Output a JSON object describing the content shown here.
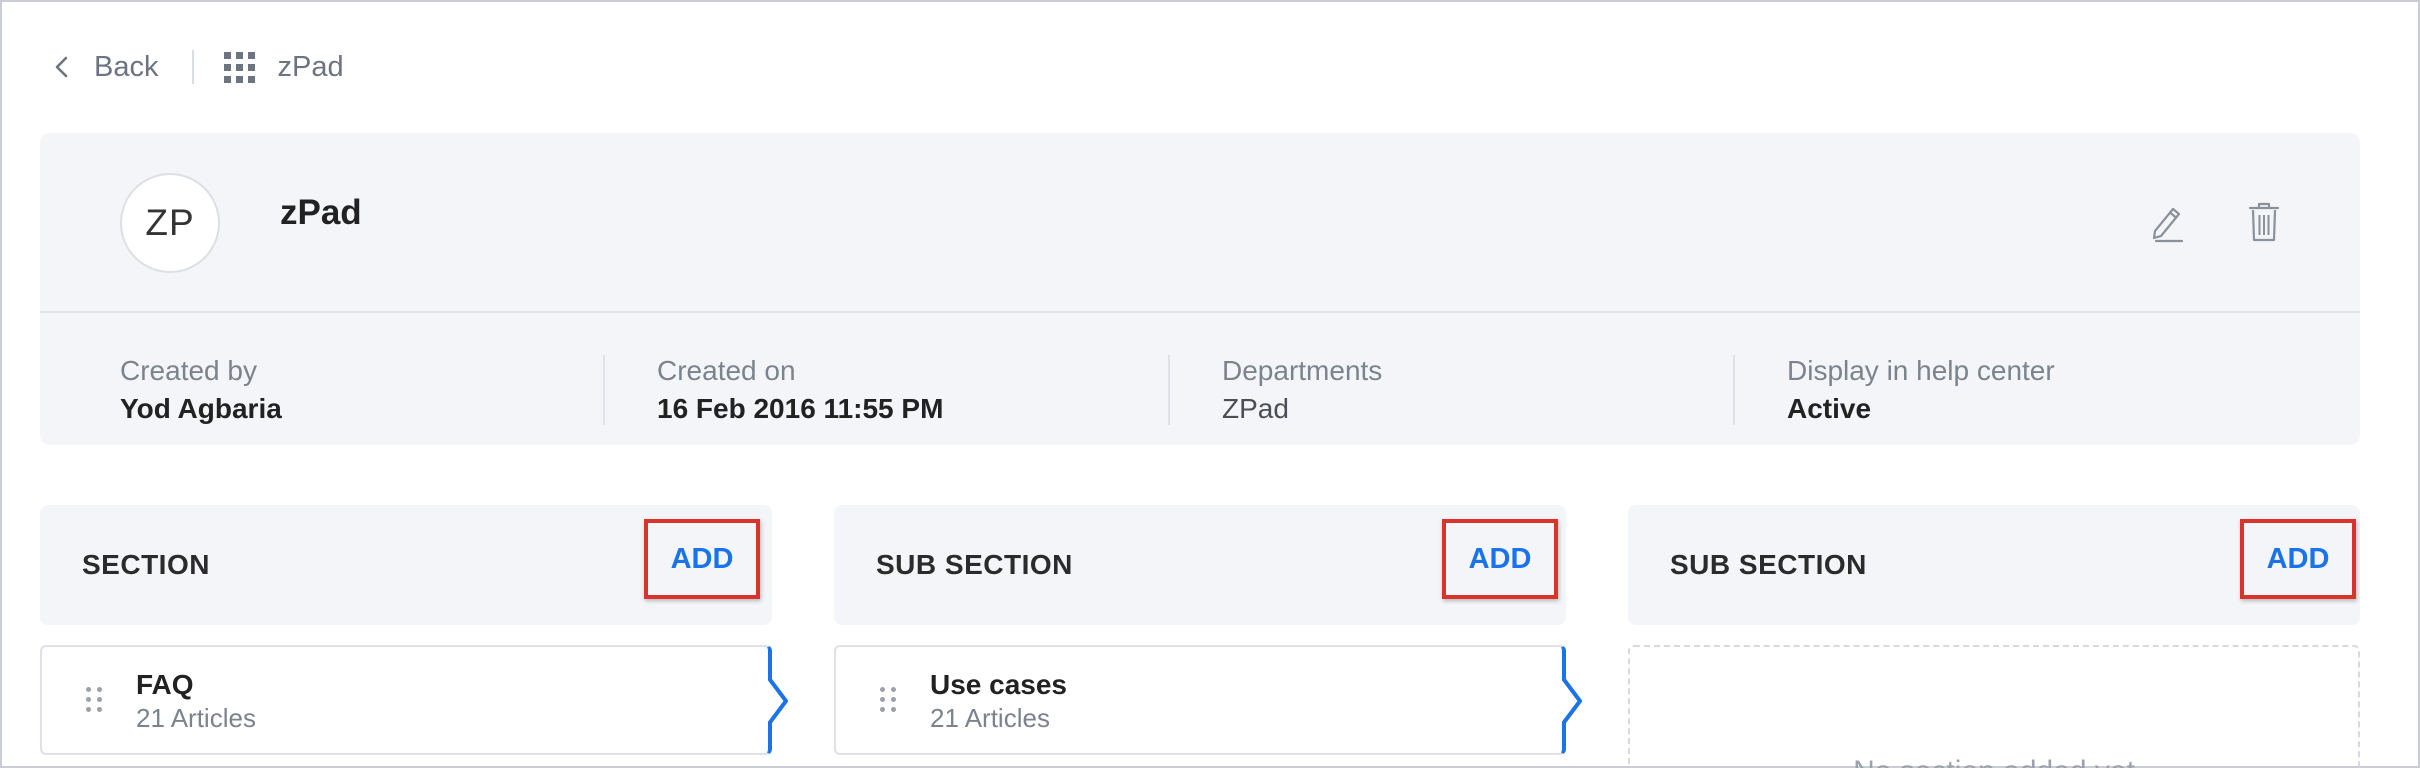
{
  "nav": {
    "back_label": "Back",
    "app_label": "zPad"
  },
  "category": {
    "avatar_initials": "ZP",
    "title": "zPad",
    "meta": [
      {
        "label": "Created by",
        "value": "Yod Agbaria"
      },
      {
        "label": "Created on",
        "value": "16 Feb 2016 11:55 PM"
      },
      {
        "label": "Departments",
        "value": "ZPad"
      },
      {
        "label": "Display in help center",
        "value": "Active"
      }
    ]
  },
  "columns": [
    {
      "title": "SECTION",
      "add_label": "ADD",
      "item": {
        "title": "FAQ",
        "subtitle": "21 Articles"
      }
    },
    {
      "title": "SUB SECTION",
      "add_label": "ADD",
      "item": {
        "title": "Use cases",
        "subtitle": "21 Articles"
      }
    },
    {
      "title": "SUB SECTION",
      "add_label": "ADD",
      "empty_text": "No section added yet"
    }
  ],
  "colors": {
    "accent": "#1a73e8",
    "highlight": "#d9342b",
    "panel": "#f4f5f8"
  }
}
